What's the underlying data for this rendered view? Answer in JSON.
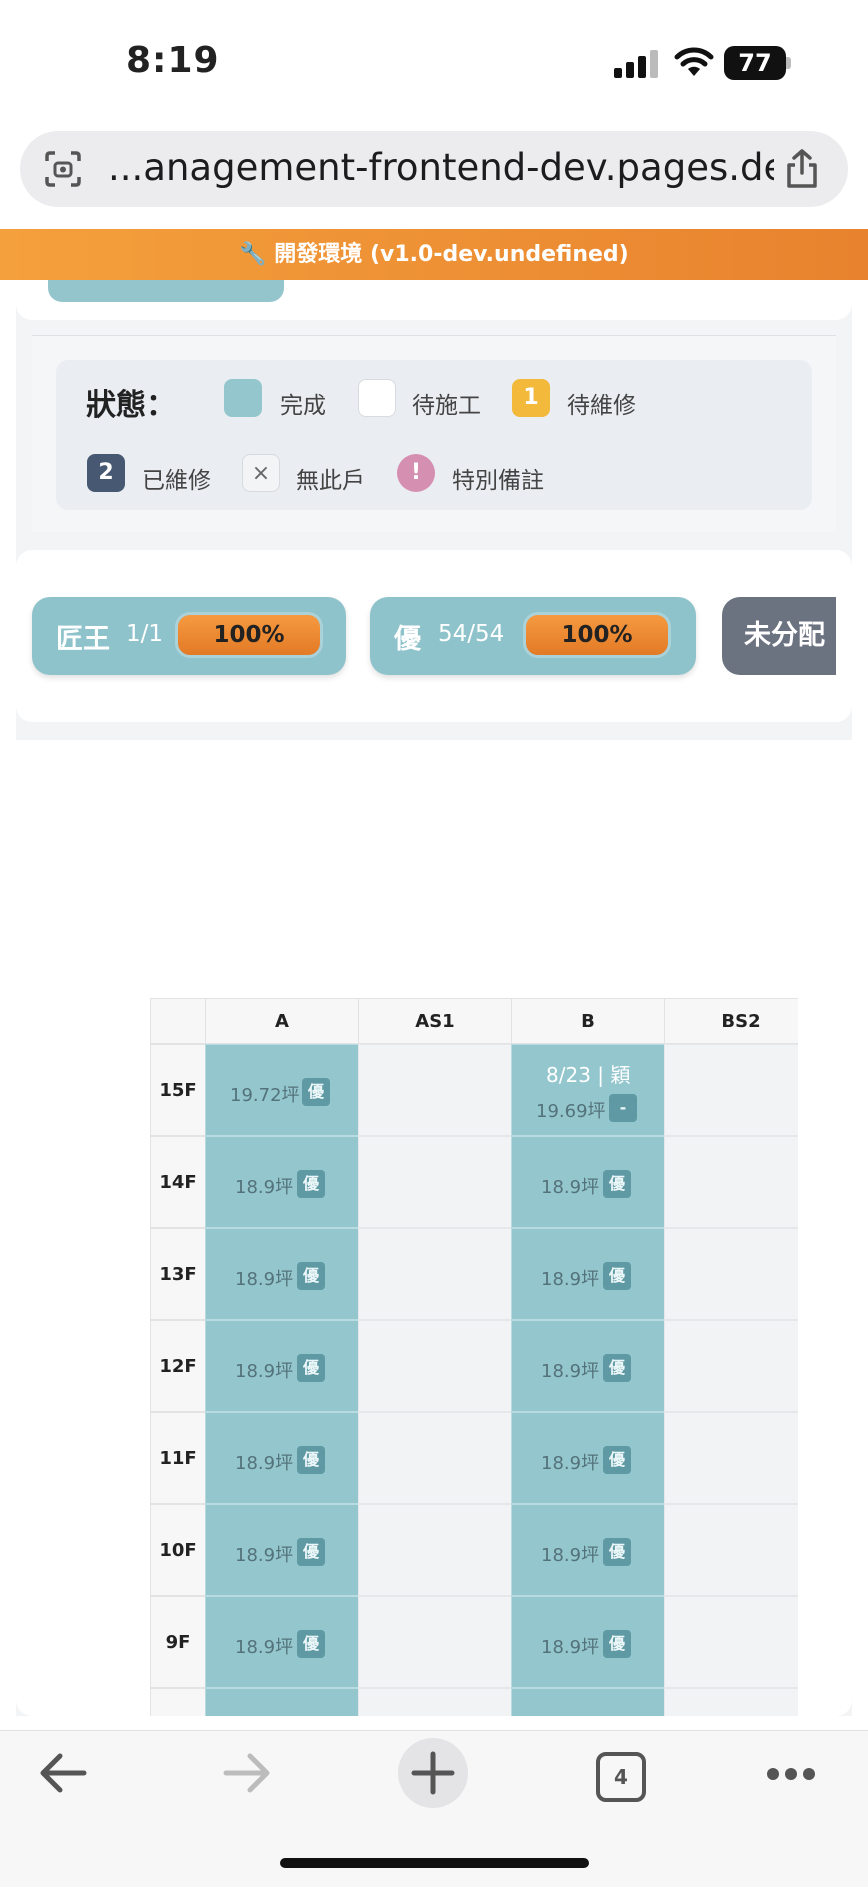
{
  "status_bar": {
    "time": "8:19",
    "battery": "77"
  },
  "url_bar": {
    "url": "...anagement-frontend-dev.pages.dev"
  },
  "dev_banner": {
    "text": "🔧 開發環境 (v1.0-dev.undefined)"
  },
  "legend": {
    "title": "狀態：",
    "items": [
      {
        "label": "完成",
        "swatch": "",
        "color": "#94c6ce"
      },
      {
        "label": "待施工",
        "swatch": "",
        "color": "#ffffff"
      },
      {
        "label": "待維修",
        "swatch": "1",
        "color": "#f2b93b"
      },
      {
        "label": "已維修",
        "swatch": "2",
        "color": "#475872"
      },
      {
        "label": "無此戶",
        "swatch": "×",
        "color": "#f3f4f6"
      },
      {
        "label": "特別備註",
        "swatch": "!",
        "color": "#d58fb0"
      }
    ]
  },
  "teams": [
    {
      "name": "匠王",
      "count": "1/1",
      "percent": "100%"
    },
    {
      "name": "優",
      "count": "54/54",
      "percent": "100%"
    }
  ],
  "unassigned_label": "未分配",
  "grid": {
    "columns": [
      "A",
      "AS1",
      "B",
      "BS2"
    ],
    "rows": [
      {
        "floor": "15F",
        "a_area": "19.72坪",
        "a_tag": "優",
        "b_date": "8/23 | 穎",
        "b_area": "19.69坪",
        "b_tag": "-"
      },
      {
        "floor": "14F",
        "a_area": "18.9坪",
        "a_tag": "優",
        "b_area": "18.9坪",
        "b_tag": "優"
      },
      {
        "floor": "13F",
        "a_area": "18.9坪",
        "a_tag": "優",
        "b_area": "18.9坪",
        "b_tag": "優"
      },
      {
        "floor": "12F",
        "a_area": "18.9坪",
        "a_tag": "優",
        "b_area": "18.9坪",
        "b_tag": "優"
      },
      {
        "floor": "11F",
        "a_area": "18.9坪",
        "a_tag": "優",
        "b_area": "18.9坪",
        "b_tag": "優"
      },
      {
        "floor": "10F",
        "a_area": "18.9坪",
        "a_tag": "優",
        "b_area": "18.9坪",
        "b_tag": "優"
      },
      {
        "floor": "9F",
        "a_area": "18.9坪",
        "a_tag": "優",
        "b_area": "18.9坪",
        "b_tag": "優"
      }
    ]
  },
  "toolbar": {
    "tabs_count": "4"
  },
  "icons": [
    "scan-icon",
    "share-icon",
    "back-icon",
    "forward-icon",
    "plus-icon",
    "tabs-icon",
    "more-icon",
    "signal-icon",
    "wifi-icon",
    "battery-icon",
    "wrench-icon"
  ]
}
